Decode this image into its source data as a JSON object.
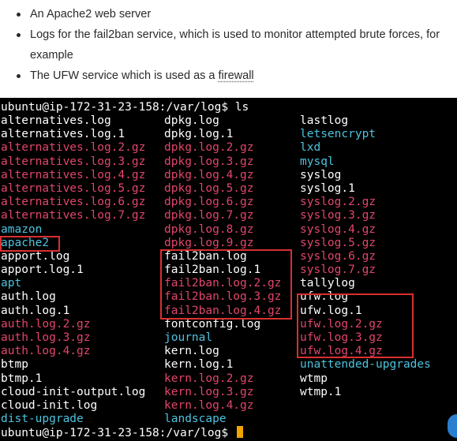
{
  "article": {
    "bullets": [
      "An Apache2 web server",
      "Logs for the fail2ban service, which is used to monitor attempted brute forces, for example",
      "The UFW service which is used as a "
    ],
    "link_text": "firewall"
  },
  "terminal": {
    "prompt_top": "ubuntu@ip-172-31-23-158:/var/log$ ls",
    "prompt_bottom": "ubuntu@ip-172-31-23-158:/var/log$ ",
    "columns": [
      [
        {
          "name": "alternatives.log",
          "type": "file"
        },
        {
          "name": "alternatives.log.1",
          "type": "file"
        },
        {
          "name": "alternatives.log.2.gz",
          "type": "archive"
        },
        {
          "name": "alternatives.log.3.gz",
          "type": "archive"
        },
        {
          "name": "alternatives.log.4.gz",
          "type": "archive"
        },
        {
          "name": "alternatives.log.5.gz",
          "type": "archive"
        },
        {
          "name": "alternatives.log.6.gz",
          "type": "archive"
        },
        {
          "name": "alternatives.log.7.gz",
          "type": "archive"
        },
        {
          "name": "amazon",
          "type": "dir"
        },
        {
          "name": "apache2",
          "type": "dir"
        },
        {
          "name": "apport.log",
          "type": "file"
        },
        {
          "name": "apport.log.1",
          "type": "file"
        },
        {
          "name": "apt",
          "type": "dir"
        },
        {
          "name": "auth.log",
          "type": "file"
        },
        {
          "name": "auth.log.1",
          "type": "file"
        },
        {
          "name": "auth.log.2.gz",
          "type": "archive"
        },
        {
          "name": "auth.log.3.gz",
          "type": "archive"
        },
        {
          "name": "auth.log.4.gz",
          "type": "archive"
        },
        {
          "name": "btmp",
          "type": "file"
        },
        {
          "name": "btmp.1",
          "type": "file"
        },
        {
          "name": "cloud-init-output.log",
          "type": "file"
        },
        {
          "name": "cloud-init.log",
          "type": "file"
        },
        {
          "name": "dist-upgrade",
          "type": "dir"
        }
      ],
      [
        {
          "name": "dpkg.log",
          "type": "file"
        },
        {
          "name": "dpkg.log.1",
          "type": "file"
        },
        {
          "name": "dpkg.log.2.gz",
          "type": "archive"
        },
        {
          "name": "dpkg.log.3.gz",
          "type": "archive"
        },
        {
          "name": "dpkg.log.4.gz",
          "type": "archive"
        },
        {
          "name": "dpkg.log.5.gz",
          "type": "archive"
        },
        {
          "name": "dpkg.log.6.gz",
          "type": "archive"
        },
        {
          "name": "dpkg.log.7.gz",
          "type": "archive"
        },
        {
          "name": "dpkg.log.8.gz",
          "type": "archive"
        },
        {
          "name": "dpkg.log.9.gz",
          "type": "archive"
        },
        {
          "name": "fail2ban.log",
          "type": "file"
        },
        {
          "name": "fail2ban.log.1",
          "type": "file"
        },
        {
          "name": "fail2ban.log.2.gz",
          "type": "archive"
        },
        {
          "name": "fail2ban.log.3.gz",
          "type": "archive"
        },
        {
          "name": "fail2ban.log.4.gz",
          "type": "archive"
        },
        {
          "name": "fontconfig.log",
          "type": "file"
        },
        {
          "name": "journal",
          "type": "dir"
        },
        {
          "name": "kern.log",
          "type": "file"
        },
        {
          "name": "kern.log.1",
          "type": "file"
        },
        {
          "name": "kern.log.2.gz",
          "type": "archive"
        },
        {
          "name": "kern.log.3.gz",
          "type": "archive"
        },
        {
          "name": "kern.log.4.gz",
          "type": "archive"
        },
        {
          "name": "landscape",
          "type": "dir"
        }
      ],
      [
        {
          "name": "lastlog",
          "type": "file"
        },
        {
          "name": "letsencrypt",
          "type": "dir"
        },
        {
          "name": "lxd",
          "type": "dir"
        },
        {
          "name": "mysql",
          "type": "dir"
        },
        {
          "name": "syslog",
          "type": "file"
        },
        {
          "name": "syslog.1",
          "type": "file"
        },
        {
          "name": "syslog.2.gz",
          "type": "archive"
        },
        {
          "name": "syslog.3.gz",
          "type": "archive"
        },
        {
          "name": "syslog.4.gz",
          "type": "archive"
        },
        {
          "name": "syslog.5.gz",
          "type": "archive"
        },
        {
          "name": "syslog.6.gz",
          "type": "archive"
        },
        {
          "name": "syslog.7.gz",
          "type": "archive"
        },
        {
          "name": "tallylog",
          "type": "file"
        },
        {
          "name": "ufw.log",
          "type": "file"
        },
        {
          "name": "ufw.log.1",
          "type": "file"
        },
        {
          "name": "ufw.log.2.gz",
          "type": "archive"
        },
        {
          "name": "ufw.log.3.gz",
          "type": "archive"
        },
        {
          "name": "ufw.log.4.gz",
          "type": "archive"
        },
        {
          "name": "unattended-upgrades",
          "type": "dir"
        },
        {
          "name": "wtmp",
          "type": "file"
        },
        {
          "name": "wtmp.1",
          "type": "file"
        }
      ]
    ],
    "highlight_color": "#d93030",
    "colors": {
      "file": "#ffffff",
      "archive": "#e2466b",
      "dir": "#4dc3de",
      "cursor": "#f0a500"
    }
  }
}
